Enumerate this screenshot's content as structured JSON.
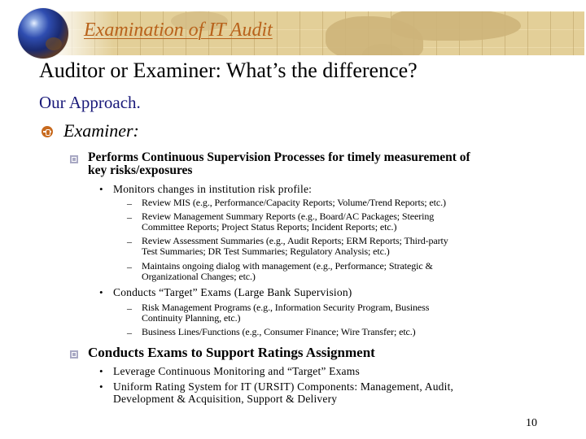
{
  "header": {
    "title": "Examination of IT Audit",
    "logo_icon": "globe-icon"
  },
  "slide": {
    "heading": "Auditor or Examiner:  What’s the difference?",
    "subheading": "Our Approach.",
    "section": {
      "label": "Examiner:",
      "bullet_icon": "orange-circle-bullet-icon"
    },
    "points": [
      {
        "text_line1": "Performs Continuous Supervision Processes for timely measurement of",
        "text_line2": "key risks/exposures",
        "subpoints": [
          {
            "text": "Monitors changes in institution risk profile:",
            "items": [
              {
                "line1": "Review MIS (e.g., Performance/Capacity Reports; Volume/Trend Reports; etc.)",
                "line2": ""
              },
              {
                "line1": "Review Management Summary Reports (e.g., Board/AC Packages; Steering",
                "line2": "Committee Reports; Project Status Reports; Incident Reports; etc.)"
              },
              {
                "line1": "Review Assessment Summaries (e.g., Audit Reports; ERM Reports; Third-party",
                "line2": "Test Summaries; DR Test Summaries; Regulatory Analysis; etc.)"
              },
              {
                "line1": "Maintains ongoing dialog with management (e.g., Performance; Strategic &",
                "line2": "Organizational Changes; etc.)"
              }
            ]
          },
          {
            "text": "Conducts “Target” Exams (Large Bank Supervision)",
            "items": [
              {
                "line1": "Risk Management Programs (e.g., Information Security Program, Business",
                "line2": "Continuity Planning, etc.)"
              },
              {
                "line1": "Business Lines/Functions (e.g., Consumer Finance; Wire Transfer; etc.)",
                "line2": ""
              }
            ]
          }
        ]
      },
      {
        "text_line1": "Conducts Exams to Support Ratings Assignment",
        "subpoints": [
          {
            "text": "Leverage Continuous Monitoring and “Target” Exams"
          },
          {
            "text": "Uniform Rating System for IT (URSIT) Components:  Management, Audit,",
            "text_line2": "Development & Acquisition, Support & Delivery"
          }
        ]
      }
    ],
    "bullets": {
      "level3": "•",
      "level4": "–"
    },
    "page_number": "10"
  },
  "colors": {
    "title": "#b8621b",
    "subheading": "#1a1a7a",
    "banner": "#e3cf98",
    "bullet_orange": "#c86a1e"
  }
}
